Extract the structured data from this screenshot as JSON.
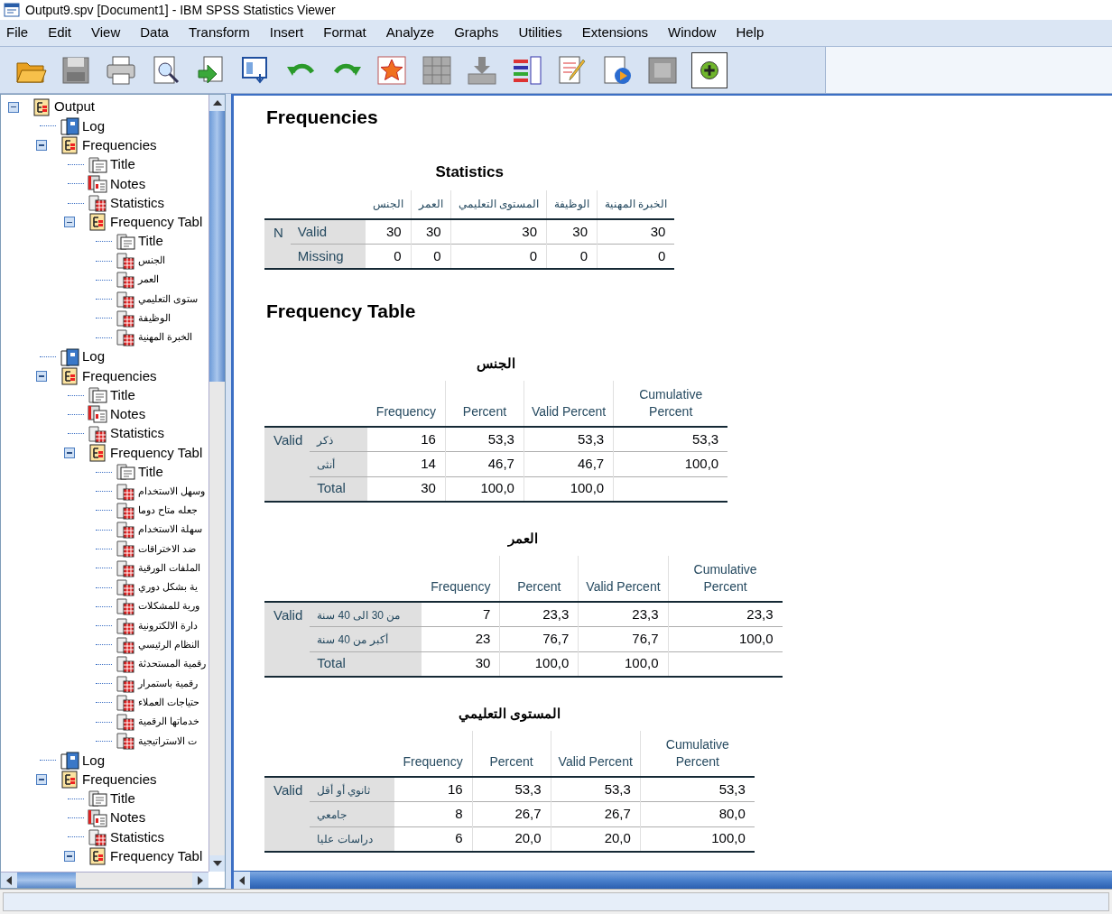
{
  "window": {
    "title": "Output9.spv [Document1] - IBM SPSS Statistics Viewer"
  },
  "menu": [
    "File",
    "Edit",
    "View",
    "Data",
    "Transform",
    "Insert",
    "Format",
    "Analyze",
    "Graphs",
    "Utilities",
    "Extensions",
    "Window",
    "Help"
  ],
  "toolbar": [
    {
      "kind": "open"
    },
    {
      "kind": "save"
    },
    {
      "kind": "print"
    },
    {
      "kind": "preview"
    },
    {
      "kind": "export"
    },
    {
      "kind": "dialog"
    },
    {
      "kind": "undo"
    },
    {
      "kind": "redo"
    },
    {
      "kind": "star"
    },
    {
      "kind": "grid"
    },
    {
      "kind": "down"
    },
    {
      "kind": "chart"
    },
    {
      "kind": "pen"
    },
    {
      "kind": "media"
    },
    {
      "kind": "frame"
    },
    {
      "kind": "plus"
    }
  ],
  "tree": [
    {
      "kind": "heading",
      "label": "Output",
      "expanded": true,
      "children": [
        {
          "kind": "log",
          "label": "Log"
        },
        {
          "kind": "heading",
          "label": "Frequencies",
          "expanded": true,
          "children": [
            {
              "kind": "title",
              "label": "Title"
            },
            {
              "kind": "notes",
              "label": "Notes"
            },
            {
              "kind": "table",
              "label": "Statistics"
            },
            {
              "kind": "heading",
              "label": "Frequency Tabl",
              "expanded": true,
              "children": [
                {
                  "kind": "title",
                  "label": "Title"
                },
                {
                  "kind": "table",
                  "label": "الجنس"
                },
                {
                  "kind": "table",
                  "label": "العمر"
                },
                {
                  "kind": "table",
                  "label": "ستوى التعليمي"
                },
                {
                  "kind": "table",
                  "label": "الوظيفة"
                },
                {
                  "kind": "table",
                  "label": "الخبرة المهنية"
                }
              ]
            }
          ]
        },
        {
          "kind": "log",
          "label": "Log"
        },
        {
          "kind": "heading",
          "label": "Frequencies",
          "expanded": true,
          "children": [
            {
              "kind": "title",
              "label": "Title"
            },
            {
              "kind": "notes",
              "label": "Notes"
            },
            {
              "kind": "table",
              "label": "Statistics"
            },
            {
              "kind": "heading",
              "label": "Frequency Tabl",
              "expanded": true,
              "children": [
                {
                  "kind": "title",
                  "label": "Title"
                },
                {
                  "kind": "table",
                  "label": "وسهل الاستخدام"
                },
                {
                  "kind": "table",
                  "label": "جعله متاح دوما"
                },
                {
                  "kind": "table",
                  "label": "سهلة الاستخدام"
                },
                {
                  "kind": "table",
                  "label": "ضد الاختراقات"
                },
                {
                  "kind": "table",
                  "label": "الملفات الورقية"
                },
                {
                  "kind": "table",
                  "label": "ية بشكل دوري"
                },
                {
                  "kind": "table",
                  "label": "ورية للمشكلات"
                },
                {
                  "kind": "table",
                  "label": "دارة الالكترونية"
                },
                {
                  "kind": "table",
                  "label": "النظام الرئيسي"
                },
                {
                  "kind": "table",
                  "label": "رقمية المستحدثة"
                },
                {
                  "kind": "table",
                  "label": "رقمية باستمرار"
                },
                {
                  "kind": "table",
                  "label": "حتياجات العملاء"
                },
                {
                  "kind": "table",
                  "label": "خدماتها الرقمية"
                },
                {
                  "kind": "table",
                  "label": "ت الاستراتيجية"
                }
              ]
            }
          ]
        },
        {
          "kind": "log",
          "label": "Log"
        },
        {
          "kind": "heading",
          "label": "Frequencies",
          "expanded": true,
          "children": [
            {
              "kind": "title",
              "label": "Title"
            },
            {
              "kind": "notes",
              "label": "Notes"
            },
            {
              "kind": "table",
              "label": "Statistics"
            },
            {
              "kind": "heading",
              "label": "Frequency Tabl",
              "expanded": true
            }
          ]
        }
      ]
    }
  ],
  "output": {
    "heading": "Frequencies",
    "statistics": {
      "title": "Statistics",
      "row_group": "N",
      "columns": [
        "الجنس",
        "العمر",
        "المستوى التعليمي",
        "الوظيفة",
        "الخبرة المهنية"
      ],
      "rows": [
        {
          "label": "Valid",
          "cells": [
            "30",
            "30",
            "30",
            "30",
            "30"
          ]
        },
        {
          "label": "Missing",
          "cells": [
            "0",
            "0",
            "0",
            "0",
            "0"
          ]
        }
      ]
    },
    "section_heading": "Frequency Table",
    "frequency_tables": [
      {
        "title": "الجنس",
        "row_group": "Valid",
        "columns": [
          "Frequency",
          "Percent",
          "Valid Percent",
          "Cumulative Percent"
        ],
        "rows": [
          {
            "label": "ذكر",
            "cells": [
              "16",
              "53,3",
              "53,3",
              "53,3"
            ]
          },
          {
            "label": "أنثى",
            "cells": [
              "14",
              "46,7",
              "46,7",
              "100,0"
            ]
          },
          {
            "label": "Total",
            "cells": [
              "30",
              "100,0",
              "100,0"
            ]
          }
        ]
      },
      {
        "title": "العمر",
        "row_group": "Valid",
        "columns": [
          "Frequency",
          "Percent",
          "Valid Percent",
          "Cumulative Percent"
        ],
        "rows": [
          {
            "label": "من 30 الى 40 سنة",
            "cells": [
              "7",
              "23,3",
              "23,3",
              "23,3"
            ]
          },
          {
            "label": "أكبر من 40 سنة",
            "cells": [
              "23",
              "76,7",
              "76,7",
              "100,0"
            ]
          },
          {
            "label": "Total",
            "cells": [
              "30",
              "100,0",
              "100,0"
            ]
          }
        ]
      },
      {
        "title": "المستوى التعليمي",
        "row_group": "Valid",
        "columns": [
          "Frequency",
          "Percent",
          "Valid Percent",
          "Cumulative Percent"
        ],
        "rows": [
          {
            "label": "ثانوي أو أقل",
            "cells": [
              "16",
              "53,3",
              "53,3",
              "53,3"
            ]
          },
          {
            "label": "جامعي",
            "cells": [
              "8",
              "26,7",
              "26,7",
              "80,0"
            ]
          },
          {
            "label": "دراسات عليا",
            "cells": [
              "6",
              "20,0",
              "20,0",
              "100,0"
            ]
          }
        ]
      }
    ]
  }
}
